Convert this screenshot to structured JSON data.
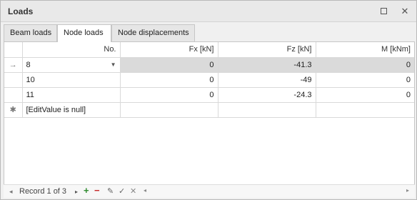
{
  "window": {
    "title": "Loads",
    "maximize_icon": "maximize-icon",
    "close_icon": "close-icon",
    "close_glyph": "✕"
  },
  "tabs": [
    {
      "label": "Beam loads",
      "active": false
    },
    {
      "label": "Node loads",
      "active": true
    },
    {
      "label": "Node displacements",
      "active": false
    }
  ],
  "grid": {
    "columns": [
      "No.",
      "Fx  [kN]",
      "Fz  [kN]",
      "M  [kNm]"
    ],
    "indicators": {
      "current": "→",
      "new": "✱"
    },
    "rows": [
      {
        "no": "8",
        "fx": "0",
        "fz": "-41.3",
        "m": "0",
        "selected": true
      },
      {
        "no": "10",
        "fx": "0",
        "fz": "-49",
        "m": "0"
      },
      {
        "no": "11",
        "fx": "0",
        "fz": "-24.3",
        "m": "0"
      }
    ],
    "new_row_text": "[EditValue is null]"
  },
  "navigator": {
    "record_text": "Record 1 of 3",
    "first_glyph": "◂",
    "next_glyph": "▸",
    "add_glyph": "+",
    "delete_glyph": "−",
    "edit_glyph": "✎",
    "ok_glyph": "✓",
    "cancel_glyph": "✕",
    "scroll_left_glyph": "◂",
    "scroll_right_glyph": "▸"
  },
  "colors": {
    "selected_row": "#dadada",
    "add": "#2e8b2e",
    "delete": "#c62828"
  }
}
